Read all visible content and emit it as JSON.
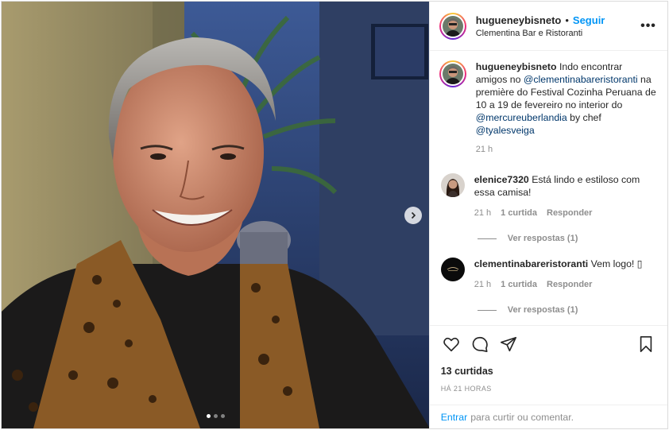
{
  "post": {
    "author": "hugueneybisneto",
    "separator": "•",
    "follow_label": "Seguir",
    "location": "Clementina Bar e Ristoranti",
    "more_label": "•••"
  },
  "caption": {
    "username": "hugueneybisneto",
    "text_1": "Indo encontrar amigos no ",
    "mention_1": "@clementinabareristoranti",
    "text_2": " na première do Festival Cozinha Peruana de 10 a 19 de fevereiro no interior do ",
    "mention_2": "@mercureuberlandia",
    "text_3": " by chef ",
    "mention_3": "@tyalesveiga",
    "time": "21 h"
  },
  "comments": [
    {
      "username": "elenice7320",
      "text": "Está lindo e estiloso com essa camisa!",
      "time": "21 h",
      "likes": "1 curtida",
      "reply": "Responder",
      "view_replies": "Ver respostas (1)"
    },
    {
      "username": "clementinabareristoranti",
      "text": "Vem logo! ▯",
      "time": "21 h",
      "likes": "1 curtida",
      "reply": "Responder",
      "view_replies": "Ver respostas (1)"
    }
  ],
  "footer": {
    "likes_count": "13 curtidas",
    "posted_time": "HÁ 21 HORAS",
    "enter_label": "Entrar",
    "comment_prompt": "para curtir ou comentar."
  },
  "icons": {
    "like": "heart-icon",
    "comment": "comment-icon",
    "share": "paper-plane-icon",
    "save": "bookmark-icon",
    "next": "chevron-right-icon"
  },
  "carousel": {
    "count": 3,
    "active_index": 0
  },
  "colors": {
    "accent": "#0095f6",
    "mention": "#00376b",
    "muted": "#8e8e8e"
  }
}
